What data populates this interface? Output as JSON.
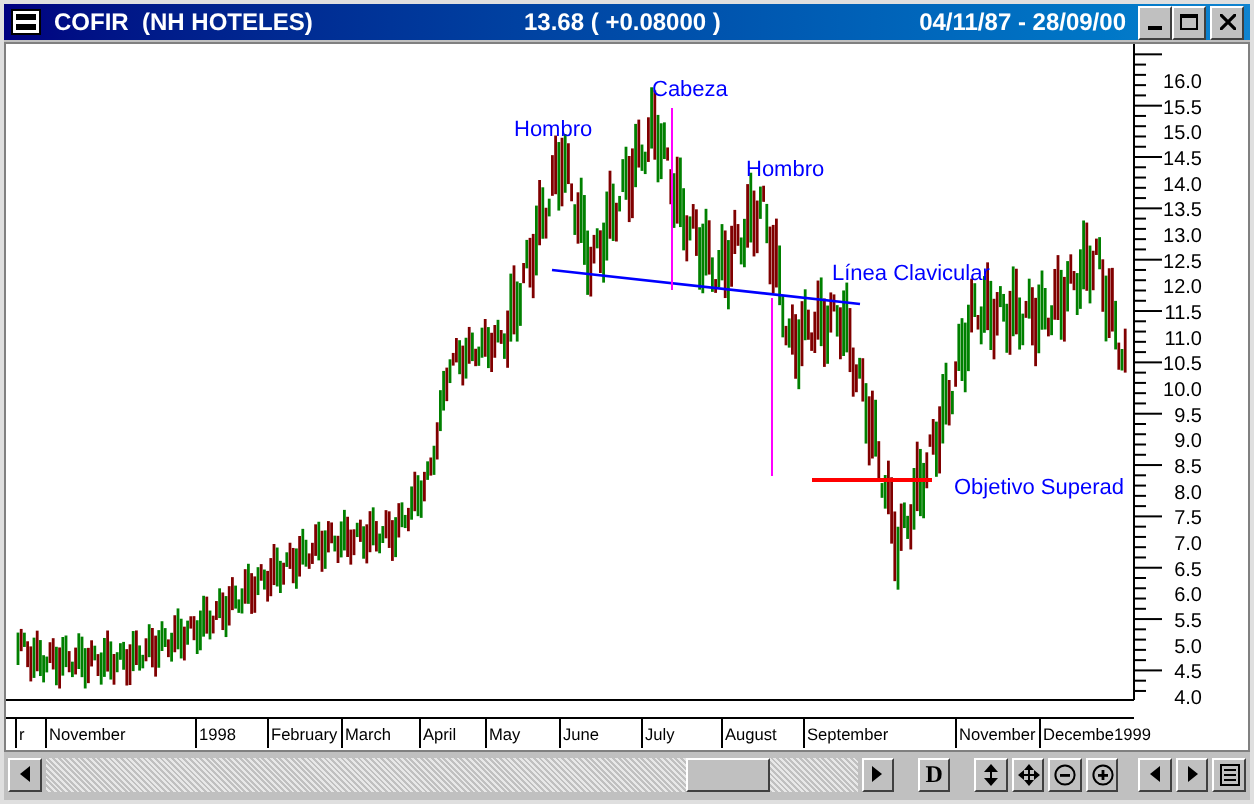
{
  "window": {
    "title": "COFIR  (NH HOTELES)",
    "quote": "13.68 ( +0.08000 )",
    "date_range": "04/11/87 - 28/09/00"
  },
  "chart": {
    "y_ticks": [
      "16.0",
      "15.5",
      "15.0",
      "14.5",
      "14.0",
      "13.5",
      "13.0",
      "12.5",
      "12.0",
      "11.5",
      "11.0",
      "10.5",
      "10.0",
      "9.5",
      "9.0",
      "8.5",
      "8.0",
      "7.5",
      "7.0",
      "6.5",
      "6.0",
      "5.5",
      "5.0",
      "4.5",
      "4.0"
    ],
    "x_labels": [
      "r",
      "November",
      "1998",
      "February",
      "March",
      "April",
      "May",
      "June",
      "July",
      "August",
      "September",
      "November",
      "Decembe1999"
    ],
    "annotations": [
      {
        "kind": "label",
        "text": "Hombro"
      },
      {
        "kind": "label",
        "text": "Cabeza"
      },
      {
        "kind": "label",
        "text": "Hombro"
      },
      {
        "kind": "label",
        "text": "Línea Clavicular"
      },
      {
        "kind": "label",
        "text": "Objetivo Superad"
      }
    ]
  },
  "toolbar": [
    {
      "label": "D"
    }
  ]
}
